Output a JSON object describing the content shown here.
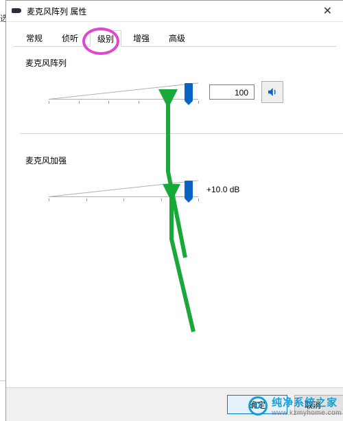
{
  "window": {
    "title": "麦克风阵列 属性",
    "close_glyph": "✕"
  },
  "tabs": {
    "items": [
      "常规",
      "侦听",
      "级别",
      "增强",
      "高级"
    ],
    "active_index": 2
  },
  "levels": {
    "mic_array": {
      "label": "麦克风阵列",
      "value": "100",
      "slider_percent": 96
    },
    "mic_boost": {
      "label": "麦克风加强",
      "value_text": "+10.0 dB",
      "slider_percent": 96
    }
  },
  "buttons": {
    "ok": "确定",
    "cancel": "取消"
  },
  "watermark": {
    "brand": "纯净系统之家",
    "url": "www.kzmyhome.com"
  },
  "sidebar_char": "选"
}
